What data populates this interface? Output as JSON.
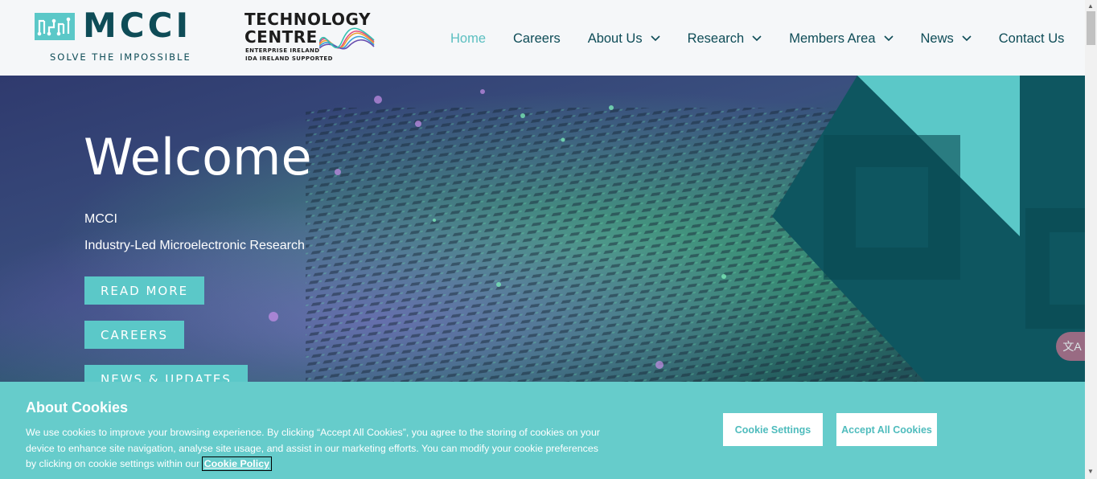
{
  "header": {
    "mcci_logo_text": "MCCI",
    "mcci_tagline": "SOLVE THE IMPOSSIBLE",
    "tc_line1": "TECHNOLOGY",
    "tc_line2": "CENTRE",
    "tc_sub1": "ENTERPRISE IRELAND",
    "tc_sub2": "IDA IRELAND SUPPORTED"
  },
  "nav": {
    "home": "Home",
    "careers": "Careers",
    "about": "About Us",
    "research": "Research",
    "members": "Members Area",
    "news": "News",
    "contact": "Contact Us"
  },
  "hero": {
    "title": "Welcome",
    "subtitle1": "MCCI",
    "subtitle2": "Industry-Led Microelectronic Research",
    "btn_read_more": "READ MORE",
    "btn_careers": "CAREERS",
    "btn_news": "NEWS & UPDATES"
  },
  "translate_label": "文A",
  "cookie": {
    "title": "About Cookies",
    "text": "We use cookies to improve your browsing experience. By clicking “Accept All Cookies”, you agree to the storing of cookies on your device to enhance site navigation, analyse site usage, and assist in our marketing efforts. You can modify your cookie preferences by clicking on cookie settings within our",
    "link": "Cookie Policy",
    "settings_btn": "Cookie Settings",
    "accept_btn": "Accept All Cookies"
  },
  "colors": {
    "brand_dark": "#0e4c57",
    "brand_teal": "#5bbfc0",
    "cookie_bg": "#66cccb"
  }
}
